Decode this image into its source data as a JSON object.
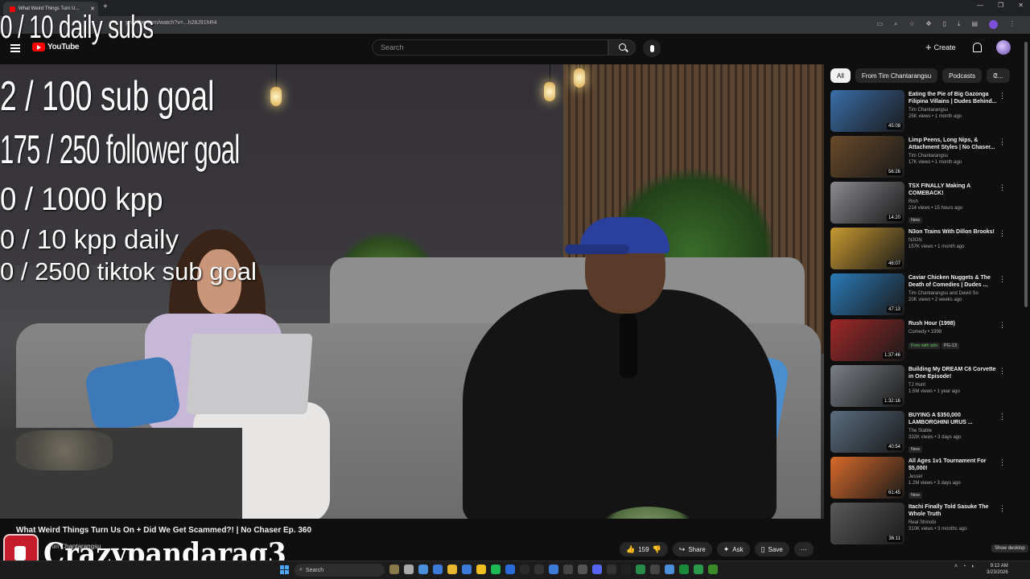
{
  "browser": {
    "tab_title": "What Weird Things Turn U...",
    "url": "youtube.com/watch?v=...h28J91hR4"
  },
  "header": {
    "logo_text": "YouTube",
    "search_placeholder": "Search",
    "create_label": "Create"
  },
  "overlay": {
    "daily_subs": "0 / 10 daily subs",
    "sub_goal": "2  / 100 sub goal",
    "follower_goal": "175 / 250 follower goal",
    "kpp": "0 / 1000 kpp",
    "kpp_daily": "0 / 10 kpp daily",
    "tiktok_goal": "0 / 2500 tiktok sub goal",
    "streamer_name": "Crazypandarag3"
  },
  "video": {
    "title": "What Weird Things Turn Us On + Did We Get Scammed?! | No Chaser Ep. 360",
    "channel": "Tim Chantarangsu",
    "likes": "159",
    "share_label": "Share",
    "ask_label": "Ask",
    "save_label": "Save"
  },
  "chips": [
    "All",
    "From Tim Chantarangsu",
    "Podcasts",
    "C..."
  ],
  "recommendations": [
    {
      "title": "Eating the Pie of Big Gazonga Filipina Villains | Dudes Behind...",
      "channel": "Tim Chantarangsu",
      "meta": "25K views • 1 month ago",
      "duration": "45:08",
      "tags": [],
      "thumb": "#3a6ea8"
    },
    {
      "title": "Limp Peens, Long Nips, & Attachment Styles | No Chaser...",
      "channel": "Tim Chantarangsu",
      "meta": "17K views • 1 month ago",
      "duration": "56:26",
      "tags": [],
      "thumb": "#6a4a2a"
    },
    {
      "title": "TSX FINALLY Making A COMEBACK!",
      "channel": "Rish",
      "meta": "214 views • 15 hours ago",
      "duration": "14:20",
      "tags": [
        "New"
      ],
      "thumb": "#8a8a90"
    },
    {
      "title": "N3on Trains With Dillon Brooks!",
      "channel": "N3ON",
      "meta": "157K views • 1 month ago",
      "duration": "46:07",
      "tags": [],
      "thumb": "#c89a30"
    },
    {
      "title": "Caviar Chicken Nuggets & The Death of Comedies | Dudes ...",
      "channel": "Tim Chantarangsu and David So",
      "meta": "20K views • 2 weeks ago",
      "duration": "47:13",
      "tags": [],
      "thumb": "#2a7ab8"
    },
    {
      "title": "Rush Hour (1998)",
      "channel": "Comedy • 1998",
      "meta": "",
      "duration": "1:37:46",
      "tags": [
        "Free with ads",
        "PG-13"
      ],
      "thumb": "#a02828"
    },
    {
      "title": "Building My DREAM C6 Corvette in One Episode!",
      "channel": "TJ Hunt",
      "meta": "1.5M views • 1 year ago",
      "duration": "1:32:16",
      "tags": [],
      "thumb": "#7a7f86"
    },
    {
      "title": "BUYING A $350,000 LAMBORGHINI URUS ...",
      "channel": "The Stable",
      "meta": "332K views • 3 days ago",
      "duration": "40:54",
      "tags": [
        "New"
      ],
      "thumb": "#5a6d80"
    },
    {
      "title": "All Ages 1v1 Tournament For $5,000!",
      "channel": "Jesser",
      "meta": "1.2M views • 3 days ago",
      "duration": "61:45",
      "tags": [
        "New"
      ],
      "thumb": "#d86a2a"
    },
    {
      "title": "Itachi Finally Told Sasuke The Whole Truth",
      "channel": "Real Shinobi",
      "meta": "310K views • 3 months ago",
      "duration": "36:11",
      "tags": [],
      "thumb": "#5a5a5a"
    }
  ],
  "taskbar": {
    "search_label": "Search",
    "show_desktop": "Show desktop",
    "time": "9:12 AM",
    "date": "3/23/2026"
  }
}
